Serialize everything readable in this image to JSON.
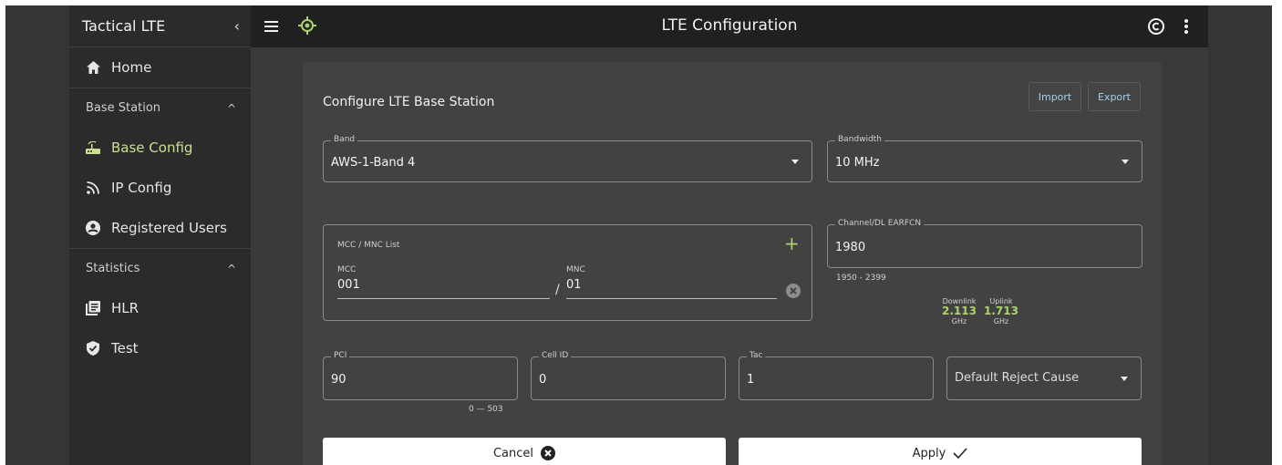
{
  "sidebar": {
    "app_title": "Tactical LTE",
    "collapse_glyph": "‹",
    "home_label": "Home",
    "sections": [
      {
        "label": "Base Station",
        "chevron": "^"
      },
      {
        "label": "Statistics",
        "chevron": "^"
      }
    ],
    "items": [
      {
        "label": "Base Config",
        "icon": "router-icon",
        "active": true
      },
      {
        "label": "IP Config",
        "icon": "rss-icon"
      },
      {
        "label": "Registered Users",
        "icon": "account-circle-icon"
      },
      {
        "label": "HLR",
        "icon": "library-icon"
      },
      {
        "label": "Test",
        "icon": "shield-check-icon"
      }
    ]
  },
  "topbar": {
    "title": "LTE Configuration"
  },
  "card": {
    "title": "Configure LTE Base Station",
    "import_label": "Import",
    "export_label": "Export",
    "band": {
      "label": "Band",
      "value": "AWS-1-Band 4"
    },
    "bandwidth": {
      "label": "Bandwidth",
      "value": "10 MHz"
    },
    "mcc_mnc": {
      "title": "MCC / MNC List",
      "add_glyph": "+",
      "mcc_label": "MCC",
      "mcc_value": "001",
      "separator": "/",
      "mnc_label": "MNC",
      "mnc_value": "01"
    },
    "earfcn": {
      "label": "Channel/DL EARFCN",
      "value": "1980",
      "range": "1950 - 2399"
    },
    "downlink": {
      "label": "Downlink",
      "value": "2.113",
      "unit": "GHz"
    },
    "uplink": {
      "label": "Uplink",
      "value": "1.713",
      "unit": "GHz"
    },
    "pci": {
      "label": "PCI",
      "value": "90",
      "range": "0 — 503"
    },
    "cell_id": {
      "label": "Cell ID",
      "value": "0"
    },
    "tac": {
      "label": "Tac",
      "value": "1"
    },
    "reject_cause": {
      "placeholder": "Default Reject Cause"
    },
    "cancel_label": "Cancel",
    "apply_label": "Apply"
  },
  "colors": {
    "accent_green": "#a9d36d",
    "link_blue": "#a7d0e8",
    "sidebar_bg": "#2b2b2b",
    "topbar_bg": "#202020",
    "card_bg": "#424242"
  }
}
